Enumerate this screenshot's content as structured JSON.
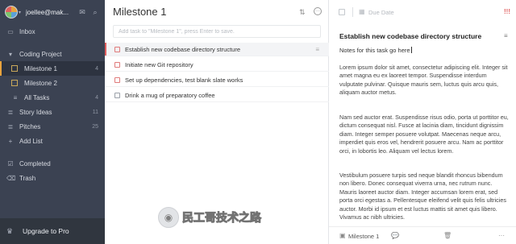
{
  "sidebar": {
    "user_email": "joellee@mak...",
    "items": [
      {
        "label": "Inbox",
        "icon": "inbox-icon",
        "glyph": "▭"
      },
      {
        "label": "Coding Project",
        "icon": "chevron-down-icon",
        "glyph": "▾"
      },
      {
        "label": "Milestone 1",
        "count": "4"
      },
      {
        "label": "Milestone 2",
        "count": ""
      },
      {
        "label": "All Tasks",
        "count": "4",
        "icon": "all-tasks-icon",
        "glyph": "≡"
      },
      {
        "label": "Story Ideas",
        "count": "11",
        "icon": "list-icon",
        "glyph": "≣"
      },
      {
        "label": "Pitches",
        "count": "25",
        "icon": "list-icon",
        "glyph": "≣"
      },
      {
        "label": "Add List",
        "icon": "plus-icon",
        "glyph": "+"
      },
      {
        "label": "Completed",
        "icon": "checkbox-icon",
        "glyph": "☑"
      },
      {
        "label": "Trash",
        "icon": "trash-icon",
        "glyph": "🗑"
      }
    ],
    "upgrade_label": "Upgrade to Pro"
  },
  "middle": {
    "title": "Milestone 1",
    "add_placeholder": "Add task to \"Milestone 1\", press Enter to save.",
    "tasks": [
      {
        "label": "Establish new codebase directory structure",
        "priority": true,
        "selected": true
      },
      {
        "label": "Initiate new Git repository",
        "priority": true
      },
      {
        "label": "Set up dependencies, test blank slate works",
        "priority": true
      },
      {
        "label": "Drink a mug of preparatory coffee",
        "priority": false
      }
    ]
  },
  "detail": {
    "due_date": "Due Date",
    "title": "Establish new codebase directory structure",
    "notes_head": "Notes for this task go here",
    "paragraphs": [
      "Lorem ipsum dolor sit amet, consectetur adipiscing elit. Integer sit amet magna eu ex laoreet tempor. Suspendisse interdum vulputate pulvinar. Quisque mauris sem, luctus quis arcu quis, aliquam auctor metus.",
      "Nam sed auctor erat. Suspendisse risus odio, porta ut porttitor eu, dictum consequat nisl. Fusce at lacinia diam, tincidunt dignissim diam. Integer semper posuere volutpat. Maecenas neque arcu, imperdiet quis eros vel, hendrerit posuere arcu. Nam ac porttitor orci, in lobortis leo. Aliquam vel lectus lorem.",
      "Vestibulum posuere turpis sed neque blandit rhoncus bibendum non libero. Donec consequat viverra urna, nec rutrum nunc. Mauris laoreet auctor diam. Integer accumsan lorem erat, sed porta orci egestas a. Pellentesque eleifend velit quis felis ultricies auctor. Morbi id ipsum et est luctus mattis sit amet quis libero. Vivamus ac nibh ultricies."
    ],
    "footer_list": "Milestone 1"
  },
  "watermark": {
    "text": "民工哥技术之路"
  },
  "colors": {
    "sidebar_bg": "#3b4252",
    "priority_red": "#e05f5f",
    "accent_orange": "#e8a33d"
  }
}
